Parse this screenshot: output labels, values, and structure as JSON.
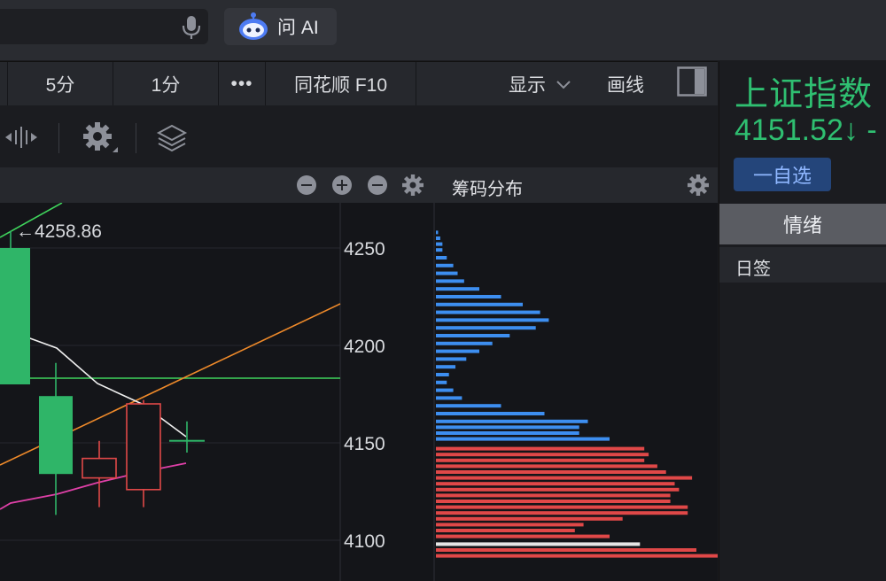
{
  "top": {
    "ask_ai_label": "问 AI"
  },
  "period_tabs": [
    {
      "label": "5分"
    },
    {
      "label": "1分"
    },
    {
      "label": "•••"
    },
    {
      "label": "同花顺 F10"
    }
  ],
  "toolbar": {
    "display_label": "显示",
    "draw_label": "画线"
  },
  "chart_header": {
    "chip_title": "筹码分布"
  },
  "chart": {
    "price_marker": "←4258.86",
    "y_ticks": [
      "4250",
      "4200",
      "4150",
      "4100"
    ]
  },
  "chart_data": {
    "type": "bar",
    "y_ticks": [
      4250,
      4200,
      4150,
      4100
    ],
    "marker_label": "←4258.86",
    "candles": [
      {
        "open": 4250,
        "close": 4180,
        "high": 4258.86,
        "low": 4180,
        "color": "green"
      },
      {
        "open": 4174,
        "close": 4134,
        "high": 4191,
        "low": 4113,
        "color": "green"
      },
      {
        "open": 4132,
        "close": 4142,
        "high": 4151,
        "low": 4117,
        "color": "red"
      },
      {
        "open": 4126,
        "close": 4170,
        "high": 4172,
        "low": 4117,
        "color": "red"
      },
      {
        "open": 4151.5,
        "close": 4151.5,
        "high": 4161,
        "low": 4145,
        "color": "green"
      }
    ],
    "chip_distribution_blue": [
      {
        "price": 4258,
        "weight": 0.5
      },
      {
        "price": 4255,
        "weight": 1
      },
      {
        "price": 4252,
        "weight": 1.5
      },
      {
        "price": 4249,
        "weight": 1.5
      },
      {
        "price": 4245,
        "weight": 2.5
      },
      {
        "price": 4241,
        "weight": 4
      },
      {
        "price": 4237,
        "weight": 5
      },
      {
        "price": 4233,
        "weight": 6.5
      },
      {
        "price": 4229,
        "weight": 10
      },
      {
        "price": 4225,
        "weight": 15
      },
      {
        "price": 4221,
        "weight": 20
      },
      {
        "price": 4217,
        "weight": 24
      },
      {
        "price": 4213,
        "weight": 26
      },
      {
        "price": 4209,
        "weight": 23
      },
      {
        "price": 4205,
        "weight": 17
      },
      {
        "price": 4201,
        "weight": 13
      },
      {
        "price": 4197,
        "weight": 10
      },
      {
        "price": 4193,
        "weight": 7
      },
      {
        "price": 4189,
        "weight": 4.5
      },
      {
        "price": 4185,
        "weight": 3
      },
      {
        "price": 4181,
        "weight": 2.5
      },
      {
        "price": 4177,
        "weight": 4
      },
      {
        "price": 4173,
        "weight": 6
      },
      {
        "price": 4169,
        "weight": 15
      },
      {
        "price": 4165,
        "weight": 25
      },
      {
        "price": 4161,
        "weight": 35
      },
      {
        "price": 4158,
        "weight": 33
      },
      {
        "price": 4155,
        "weight": 33
      },
      {
        "price": 4152,
        "weight": 40
      }
    ],
    "chip_distribution_red": [
      {
        "price": 4147,
        "weight": 48
      },
      {
        "price": 4144,
        "weight": 49
      },
      {
        "price": 4141,
        "weight": 48
      },
      {
        "price": 4138,
        "weight": 51
      },
      {
        "price": 4135,
        "weight": 53
      },
      {
        "price": 4132,
        "weight": 59
      },
      {
        "price": 4129,
        "weight": 55
      },
      {
        "price": 4126,
        "weight": 56
      },
      {
        "price": 4123,
        "weight": 54
      },
      {
        "price": 4120,
        "weight": 54
      },
      {
        "price": 4117,
        "weight": 58
      },
      {
        "price": 4114,
        "weight": 58
      },
      {
        "price": 4111,
        "weight": 43
      },
      {
        "price": 4108,
        "weight": 34
      },
      {
        "price": 4105,
        "weight": 32
      },
      {
        "price": 4102,
        "weight": 40
      },
      {
        "price": 4098,
        "weight": 47,
        "color": "white"
      },
      {
        "price": 4095,
        "weight": 60
      },
      {
        "price": 4092,
        "weight": 66
      }
    ]
  },
  "right_panel": {
    "stock_name": "上证指数",
    "price": "4151.52↓ -",
    "favorite_label": "一自选",
    "mood_tab": "情绪",
    "rijian_label": "日签"
  },
  "colors": {
    "up": "#e04848",
    "down": "#2fb568",
    "chip_blue": "#3d8ef0",
    "accent_green": "#2fbf71"
  }
}
